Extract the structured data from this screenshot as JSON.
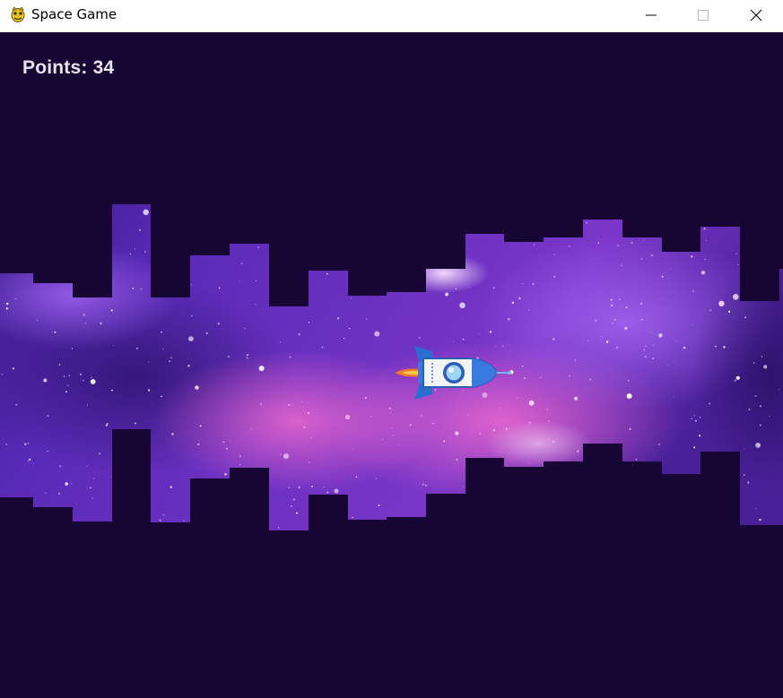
{
  "window": {
    "title": "Space Game",
    "icon": "pygame-snake-icon",
    "controls": [
      "minimize-icon",
      "maximize-icon",
      "close-icon"
    ]
  },
  "hud": {
    "points_label": "Points:",
    "points_value": "34"
  },
  "game": {
    "background_color": "#170533",
    "player": "rocket-ship",
    "obstacles": "city-skyline-silhouettes-top-and-bottom",
    "nebula_colors": [
      "#2a1470",
      "#6a2fc4",
      "#b04fd8",
      "#e060c0"
    ]
  }
}
